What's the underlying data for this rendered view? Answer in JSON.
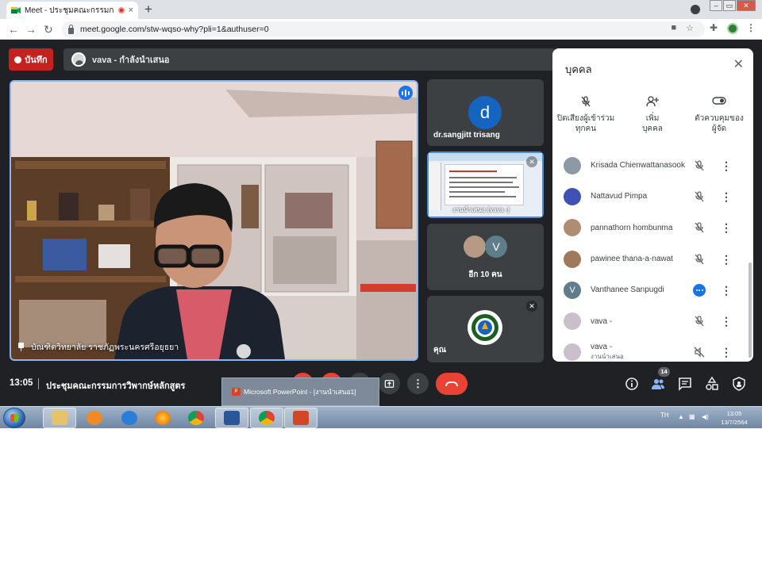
{
  "browser": {
    "tab_title": "Meet - ประชุมคณะกรรมการวิพาก",
    "tab_close": "×",
    "new_tab": "+",
    "url": "meet.google.com/stw-wqso-why?pli=1&authuser=0",
    "nav_back": "←",
    "nav_forward": "→",
    "nav_reload": "↻",
    "window_min": "–",
    "window_max": "▭",
    "window_close": "✕"
  },
  "meet": {
    "record_label": "บันทึก",
    "presenting_text": "vava - กำลังนำเสนอ",
    "main_speaker_name": "บัณฑิตวิทยาลัย ราชภัฏพระนครศรีอยุธยา",
    "tiles": [
      {
        "avatar_letter": "d",
        "name": "dr.sangjitt trisang"
      },
      {
        "name": "งานนำเสนอ (vava -)"
      },
      {
        "avatar_letter": "V",
        "name": "อีก 10 คน"
      },
      {
        "name": "คุณ"
      }
    ]
  },
  "people_panel": {
    "title": "บุคคล",
    "close": "✕",
    "actions": [
      {
        "icon": "mic-off-icon",
        "line1": "ปิดเสียงผู้เข้าร่วม",
        "line2": "ทุกคน"
      },
      {
        "icon": "person-add-icon",
        "line1": "เพิ่ม",
        "line2": "บุคคล"
      },
      {
        "icon": "toggle-icon",
        "line1": "ตัวควบคุมของ",
        "line2": "ผู้จัด"
      }
    ],
    "participants": [
      {
        "name": "Krisada Chienwattanasook",
        "sub": "",
        "status": "muted",
        "avatar_letter": ""
      },
      {
        "name": "Nattavud Pimpa",
        "sub": "",
        "status": "muted",
        "avatar_letter": ""
      },
      {
        "name": "pannathorn hombunma",
        "sub": "",
        "status": "muted",
        "avatar_letter": ""
      },
      {
        "name": "pawinee thana-a-nawat",
        "sub": "",
        "status": "muted",
        "avatar_letter": ""
      },
      {
        "name": "Vanthanee Sanpugdi",
        "sub": "",
        "status": "speaking",
        "avatar_letter": "V"
      },
      {
        "name": "vava -",
        "sub": "",
        "status": "muted",
        "avatar_letter": ""
      },
      {
        "name": "vava -",
        "sub": "งานนำเสนอ",
        "status": "presentation-muted",
        "avatar_letter": ""
      }
    ]
  },
  "controls": {
    "clock": "13:05",
    "meeting_title": "ประชุมคณะกรรมการวิพากษ์หลักสูตร",
    "people_count": "14",
    "more": "⋮"
  },
  "taskbar": {
    "popup_label": "Microsoft PowerPoint - [งานนำเสนอ1]",
    "lang": "TH",
    "time": "13:05",
    "date": "13/7/2564"
  },
  "colors": {
    "meet_bg": "#202124",
    "record_red": "#c5221f",
    "speaking_blue": "#1a73e8",
    "end_call_red": "#ea4335"
  }
}
